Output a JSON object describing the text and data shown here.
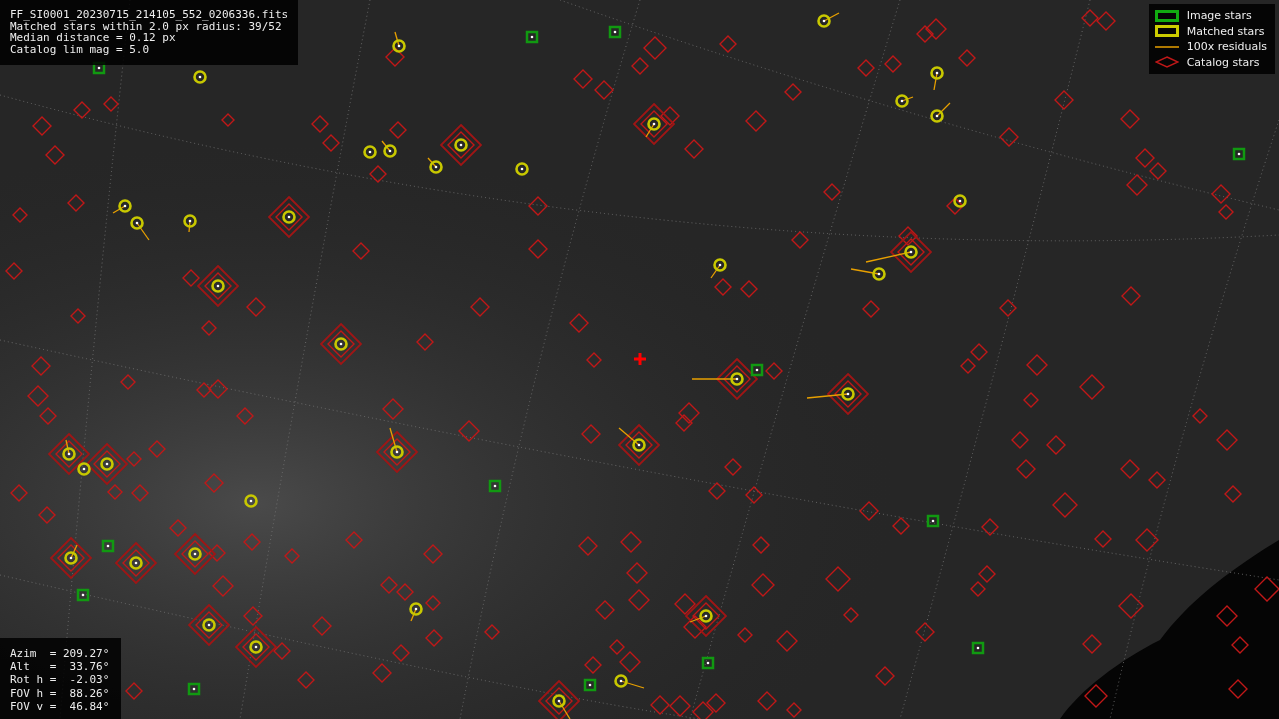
{
  "info": {
    "lines": [
      "FF_SI0001_20230715_214105_552_0206336.fits",
      "Matched stars within 2.0 px radius: 39/52",
      "Median distance = 0.12 px",
      "Catalog lim mag = 5.0"
    ]
  },
  "legend": [
    {
      "kind": "image",
      "label": "Image stars"
    },
    {
      "kind": "matched",
      "label": "Matched stars"
    },
    {
      "kind": "residual",
      "label": "100x residuals"
    },
    {
      "kind": "catalog",
      "label": "Catalog stars"
    }
  ],
  "pointing": {
    "lines": [
      "Azim  = 209.27°",
      "Alt   =  33.76°",
      "Rot h =  -2.03°",
      "FOV h =  88.26°",
      "FOV v =  46.84°"
    ]
  }
}
